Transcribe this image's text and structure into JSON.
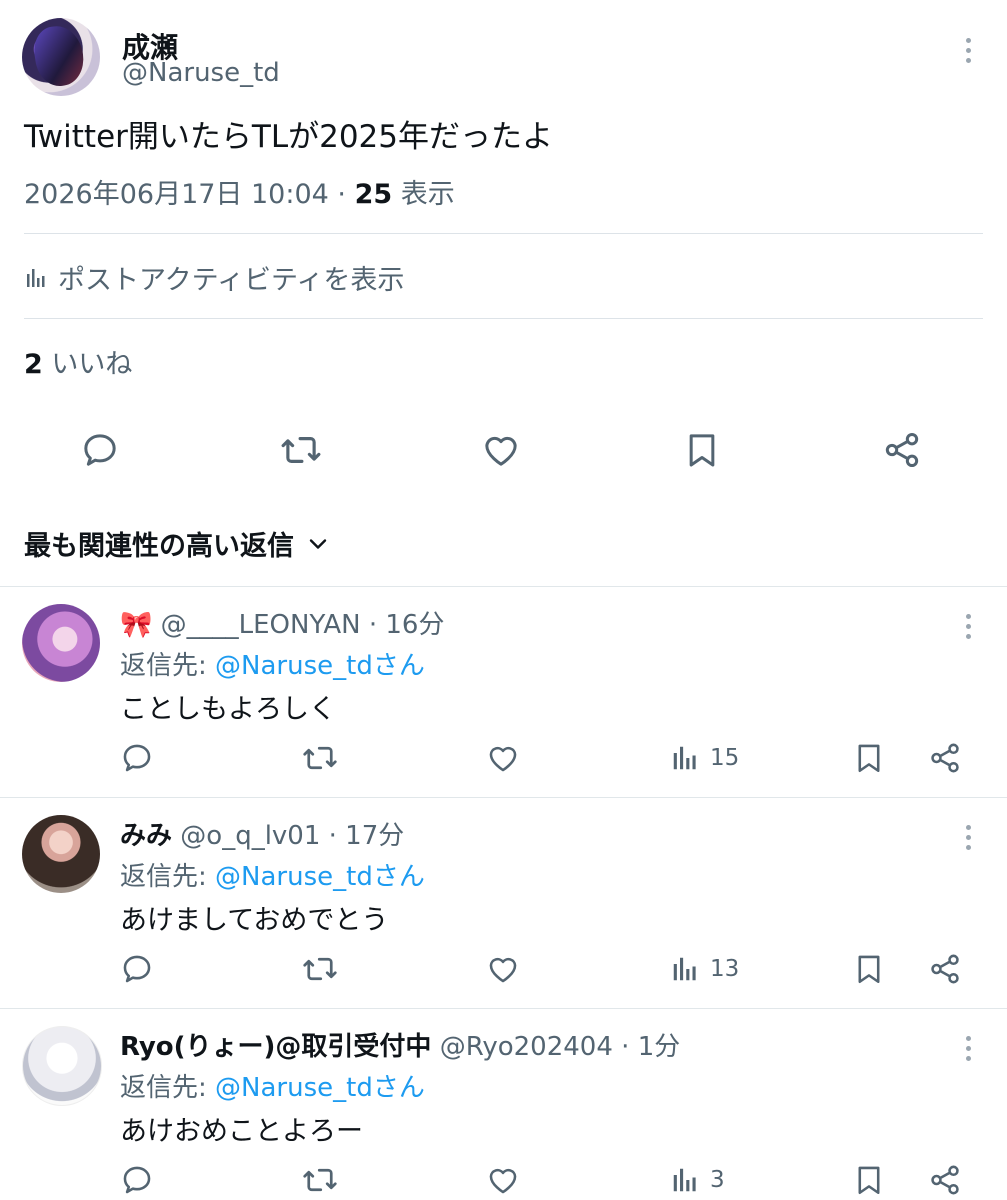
{
  "post": {
    "display_name": "成瀬",
    "handle": "@Naruse_td",
    "text": "Twitter開いたらTLが2025年だったよ",
    "timestamp": "2026年06月17日 10:04 · ",
    "views_count": "25",
    "views_label": " 表示",
    "activity_label": "ポストアクティビティを表示",
    "likes_count": "2",
    "likes_label": " いいね"
  },
  "sort": {
    "label": "最も関連性の高い返信"
  },
  "replies": [
    {
      "emoji": "🎀",
      "display_name": "",
      "handle": "@____LEONYAN",
      "time": " · 16分",
      "reply_to_prefix": "返信先: ",
      "reply_to_handle": "@Naruse_tdさん",
      "text": "ことしもよろしく",
      "views": "15"
    },
    {
      "emoji": "",
      "display_name": "みみ",
      "handle": "@o_q_lv01",
      "time": " · 17分",
      "reply_to_prefix": "返信先: ",
      "reply_to_handle": "@Naruse_tdさん",
      "text": "あけましておめでとう",
      "views": "13"
    },
    {
      "emoji": "",
      "display_name": "Ryo(りょー)@取引受付中",
      "handle": "@Ryo202404",
      "time": " · 1分",
      "reply_to_prefix": "返信先: ",
      "reply_to_handle": "@Naruse_tdさん",
      "text": "あけおめことよろー",
      "views": "3"
    }
  ],
  "icons": {
    "more": "more-vertical-icon",
    "reply": "reply-icon",
    "repost": "repost-icon",
    "like": "like-heart-icon",
    "bookmark": "bookmark-icon",
    "share": "share-icon",
    "views": "views-bar-chart-icon",
    "chevron": "chevron-down-icon"
  },
  "colors": {
    "text": "#0f1419",
    "muted": "#536471",
    "link": "#1d9bf0",
    "divider": "#e1e7ea"
  }
}
